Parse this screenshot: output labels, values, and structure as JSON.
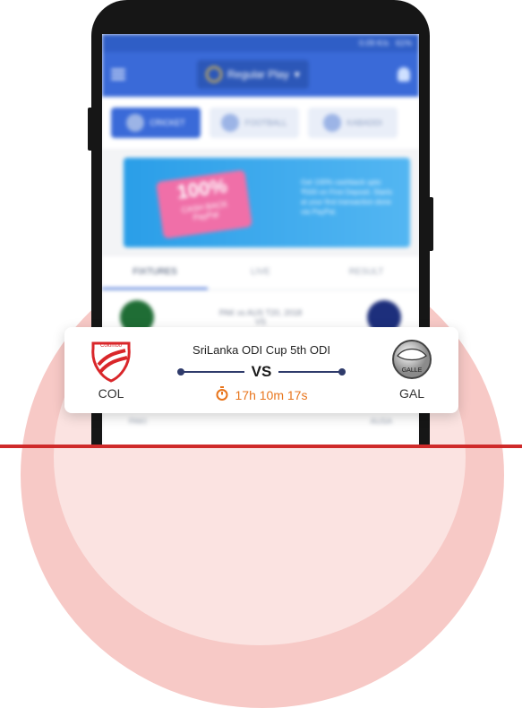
{
  "background": {
    "accent": "#f7c9c6"
  },
  "statusbar": {
    "speed": "0.09 K/s",
    "battery": "61%"
  },
  "appbar": {
    "mode_label": "Regular Play"
  },
  "sports": [
    {
      "label": "CRICKET"
    },
    {
      "label": "FOOTBALL"
    },
    {
      "label": "KABADDI"
    }
  ],
  "banner": {
    "headline": "100%",
    "subline": "CASH BACK",
    "partner": "PayPal",
    "text": "Get 100% cashback upto ₹500 on First Deposit. Starts at your first transaction done via PayPal."
  },
  "tabs": [
    {
      "label": "FIXTURES"
    },
    {
      "label": "LIVE"
    },
    {
      "label": "RESULT"
    }
  ],
  "fixture": {
    "title": "PAK vs AUS T20, 2018",
    "vs": "VS",
    "left": "PAKI",
    "right": "AUSA"
  },
  "card": {
    "match_title": "SriLanka ODI Cup 5th ODI",
    "vs": "VS",
    "team_left": {
      "code": "COL",
      "logo_text": "Colombo"
    },
    "team_right": {
      "code": "GAL",
      "logo_text": "GALLE"
    },
    "countdown": "17h 10m 17s"
  },
  "colors": {
    "brand_blue": "#3a6ad8",
    "timer_orange": "#e8751c",
    "red": "#cf2a2a"
  },
  "icons": [
    "menu-icon",
    "bell-icon",
    "stopwatch-icon",
    "colombo-logo",
    "galle-logo"
  ]
}
